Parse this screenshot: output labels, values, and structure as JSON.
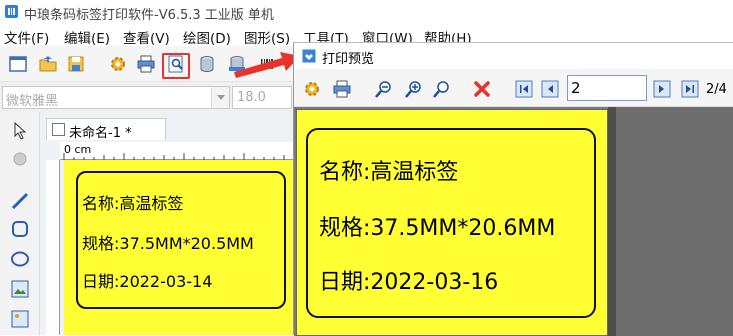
{
  "main_window": {
    "title": "中琅条码标签打印软件-V6.5.3 工业版 单机"
  },
  "menu": {
    "items": [
      "文件(F)",
      "编辑(E)",
      "查看(V)",
      "绘图(D)",
      "图形(S)",
      "工具(T)",
      "窗口(W)",
      "帮助(H)"
    ]
  },
  "toolbar": {
    "icons": [
      "new-icon",
      "open-icon",
      "save-icon",
      "settings-icon",
      "print-icon",
      "print-preview-icon",
      "database-icon",
      "database-settings-icon",
      "barcode-icon"
    ]
  },
  "font_row": {
    "font_name": "微软雅黑",
    "font_size": "18.0"
  },
  "document": {
    "tab_label": "未命名-1 *",
    "ruler_label": "0 cm"
  },
  "label_left": {
    "name_line": "名称:高温标签",
    "spec_line": "规格:37.5MM*20.5MM",
    "date_line": "日期:2022-03-14"
  },
  "preview": {
    "title": "打印预览",
    "page_value": "2",
    "page_total": "2/4",
    "label": {
      "name_line": "名称:高温标签",
      "spec_line": "规格:37.5MM*20.6MM",
      "date_line": "日期:2022-03-16"
    }
  },
  "colors": {
    "label_fill": "#ffff33",
    "highlight": "#e8322b",
    "preview_bg": "#808080"
  }
}
